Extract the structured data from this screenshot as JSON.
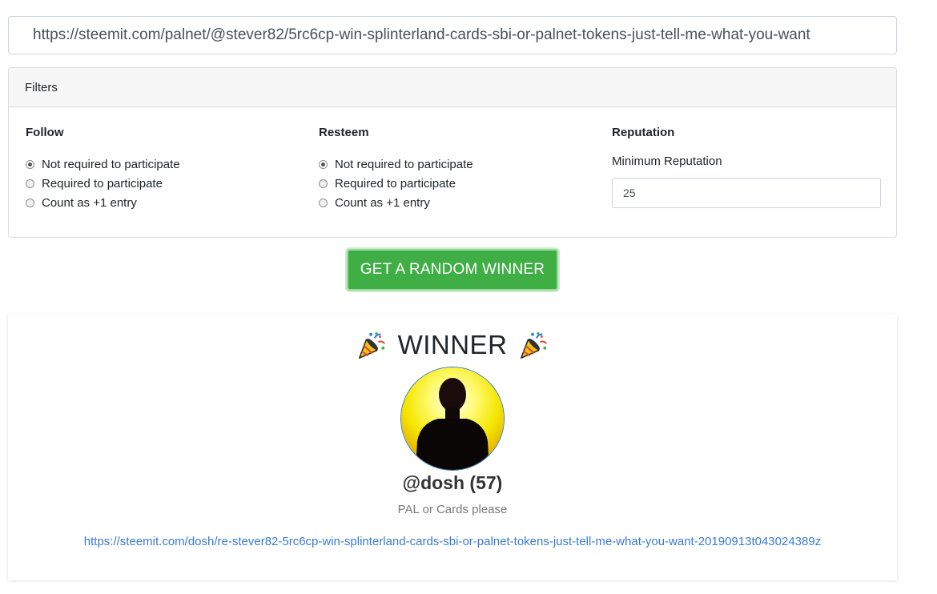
{
  "url_input": {
    "value": "https://steemit.com/palnet/@stever82/5rc6cp-win-splinterland-cards-sbi-or-palnet-tokens-just-tell-me-what-you-want"
  },
  "filters": {
    "title": "Filters",
    "follow": {
      "heading": "Follow",
      "options": [
        "Not required to participate",
        "Required to participate",
        "Count as +1 entry"
      ],
      "selected": 0
    },
    "resteem": {
      "heading": "Resteem",
      "options": [
        "Not required to participate",
        "Required to participate",
        "Count as +1 entry"
      ],
      "selected": 0
    },
    "reputation": {
      "heading": "Reputation",
      "label": "Minimum Reputation",
      "value": "25"
    }
  },
  "action": {
    "button_label": "GET A RANDOM WINNER",
    "color": "#3fae45"
  },
  "winner": {
    "title": "WINNER",
    "icon": "party-popper-icon",
    "username": "@dosh (57)",
    "comment": "PAL or Cards please",
    "link": "https://steemit.com/dosh/re-stever82-5rc6cp-win-splinterland-cards-sbi-or-palnet-tokens-just-tell-me-what-you-want-20190913t043024389z"
  }
}
